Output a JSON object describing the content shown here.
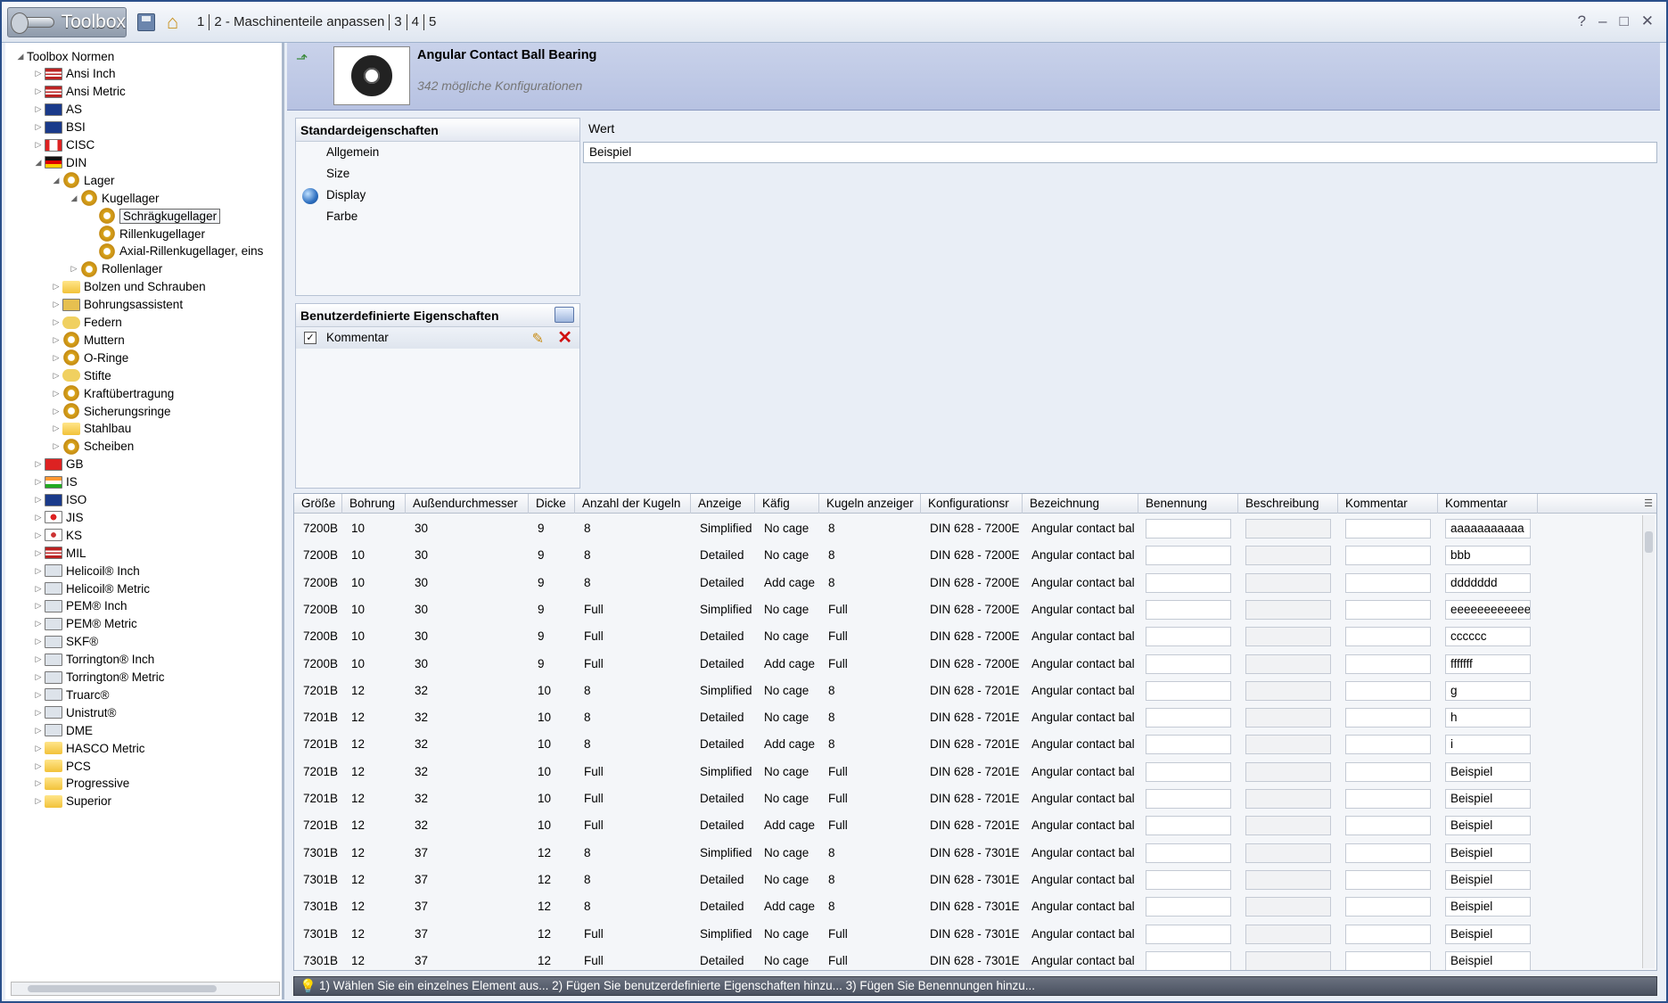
{
  "app": {
    "title": "Toolbox"
  },
  "breadcrumb": [
    "1",
    "2 - Maschinenteile anpassen",
    "3",
    "4",
    "5"
  ],
  "window_controls": [
    "?",
    "–",
    "□",
    "✕"
  ],
  "tree": [
    {
      "label": "Toolbox Normen",
      "level": 0,
      "expanded": true,
      "icon": "none"
    },
    {
      "label": "Ansi Inch",
      "level": 1,
      "icon": "flag-us"
    },
    {
      "label": "Ansi Metric",
      "level": 1,
      "icon": "flag-us"
    },
    {
      "label": "AS",
      "level": 1,
      "icon": "flag-au"
    },
    {
      "label": "BSI",
      "level": 1,
      "icon": "flag-uk"
    },
    {
      "label": "CISC",
      "level": 1,
      "icon": "flag-ca"
    },
    {
      "label": "DIN",
      "level": 1,
      "expanded": true,
      "icon": "flag-de"
    },
    {
      "label": "Lager",
      "level": 2,
      "expanded": true,
      "icon": "gear"
    },
    {
      "label": "Kugellager",
      "level": 3,
      "expanded": true,
      "icon": "gear"
    },
    {
      "label": "Schrägkugellager",
      "level": 4,
      "icon": "gear",
      "selected": true
    },
    {
      "label": "Rillenkugellager",
      "level": 4,
      "icon": "gear"
    },
    {
      "label": "Axial-Rillenkugellager, eins",
      "level": 4,
      "icon": "gear"
    },
    {
      "label": "Rollenlager",
      "level": 3,
      "icon": "gear"
    },
    {
      "label": "Bolzen und Schrauben",
      "level": 2,
      "icon": "folder"
    },
    {
      "label": "Bohrungsassistent",
      "level": 2,
      "icon": "drill"
    },
    {
      "label": "Federn",
      "level": 2,
      "icon": "part"
    },
    {
      "label": "Muttern",
      "level": 2,
      "icon": "gear"
    },
    {
      "label": "O-Ringe",
      "level": 2,
      "icon": "gear"
    },
    {
      "label": "Stifte",
      "level": 2,
      "icon": "part"
    },
    {
      "label": "Kraftübertragung",
      "level": 2,
      "icon": "gear"
    },
    {
      "label": "Sicherungsringe",
      "level": 2,
      "icon": "gear"
    },
    {
      "label": "Stahlbau",
      "level": 2,
      "icon": "folder"
    },
    {
      "label": "Scheiben",
      "level": 2,
      "icon": "gear"
    },
    {
      "label": "GB",
      "level": 1,
      "icon": "flag-cn"
    },
    {
      "label": "IS",
      "level": 1,
      "icon": "flag-in"
    },
    {
      "label": "ISO",
      "level": 1,
      "icon": "flag-iso"
    },
    {
      "label": "JIS",
      "level": 1,
      "icon": "flag-jp"
    },
    {
      "label": "KS",
      "level": 1,
      "icon": "flag-kr"
    },
    {
      "label": "MIL",
      "level": 1,
      "icon": "flag-us"
    },
    {
      "label": "Helicoil® Inch",
      "level": 1,
      "icon": "vendor"
    },
    {
      "label": "Helicoil® Metric",
      "level": 1,
      "icon": "vendor"
    },
    {
      "label": "PEM® Inch",
      "level": 1,
      "icon": "vendor"
    },
    {
      "label": "PEM® Metric",
      "level": 1,
      "icon": "vendor"
    },
    {
      "label": "SKF®",
      "level": 1,
      "icon": "vendor"
    },
    {
      "label": "Torrington® Inch",
      "level": 1,
      "icon": "vendor"
    },
    {
      "label": "Torrington® Metric",
      "level": 1,
      "icon": "vendor"
    },
    {
      "label": "Truarc®",
      "level": 1,
      "icon": "vendor"
    },
    {
      "label": "Unistrut®",
      "level": 1,
      "icon": "vendor"
    },
    {
      "label": "DME",
      "level": 1,
      "icon": "vendor"
    },
    {
      "label": "HASCO Metric",
      "level": 1,
      "icon": "folder"
    },
    {
      "label": "PCS",
      "level": 1,
      "icon": "folder"
    },
    {
      "label": "Progressive",
      "level": 1,
      "icon": "folder"
    },
    {
      "label": "Superior",
      "level": 1,
      "icon": "folder"
    }
  ],
  "component": {
    "title": "Angular Contact Ball Bearing",
    "subtitle": "342 mögliche Konfigurationen"
  },
  "standard_props": {
    "title": "Standardeigenschaften",
    "items": [
      "Allgemein",
      "Size",
      "Display",
      "Farbe"
    ]
  },
  "custom_props": {
    "title": "Benutzerdefinierte Eigenschaften",
    "items": [
      {
        "label": "Kommentar",
        "checked": true
      }
    ]
  },
  "value": {
    "label": "Wert",
    "field": "Beispiel"
  },
  "grid": {
    "columns": [
      "Größe",
      "Bohrung",
      "Außendurchmesser",
      "Dicke",
      "Anzahl der Kugeln",
      "Anzeige",
      "Käfig",
      "Kugeln anzeiger",
      "Konfigurationsr",
      "Bezeichnung",
      "Benennung",
      "Beschreibung",
      "Kommentar",
      "Kommentar"
    ],
    "rows": [
      [
        "7200B",
        "10",
        "30",
        "9",
        "8",
        "Simplified",
        "No cage",
        "8",
        "DIN 628 - 7200E",
        "Angular contact bal",
        "",
        "",
        "",
        "aaaaaaaaaaa"
      ],
      [
        "7200B",
        "10",
        "30",
        "9",
        "8",
        "Detailed",
        "No cage",
        "8",
        "DIN 628 - 7200E",
        "Angular contact bal",
        "",
        "",
        "",
        "bbb"
      ],
      [
        "7200B",
        "10",
        "30",
        "9",
        "8",
        "Detailed",
        "Add cage",
        "8",
        "DIN 628 - 7200E",
        "Angular contact bal",
        "",
        "",
        "",
        "ddddddd"
      ],
      [
        "7200B",
        "10",
        "30",
        "9",
        "Full",
        "Simplified",
        "No cage",
        "Full",
        "DIN 628 - 7200E",
        "Angular contact bal",
        "",
        "",
        "",
        "eeeeeeeeeeee"
      ],
      [
        "7200B",
        "10",
        "30",
        "9",
        "Full",
        "Detailed",
        "No cage",
        "Full",
        "DIN 628 - 7200E",
        "Angular contact bal",
        "",
        "",
        "",
        "cccccc"
      ],
      [
        "7200B",
        "10",
        "30",
        "9",
        "Full",
        "Detailed",
        "Add cage",
        "Full",
        "DIN 628 - 7200E",
        "Angular contact bal",
        "",
        "",
        "",
        "fffffff"
      ],
      [
        "7201B",
        "12",
        "32",
        "10",
        "8",
        "Simplified",
        "No cage",
        "8",
        "DIN 628 - 7201E",
        "Angular contact bal",
        "",
        "",
        "",
        "g"
      ],
      [
        "7201B",
        "12",
        "32",
        "10",
        "8",
        "Detailed",
        "No cage",
        "8",
        "DIN 628 - 7201E",
        "Angular contact bal",
        "",
        "",
        "",
        "h"
      ],
      [
        "7201B",
        "12",
        "32",
        "10",
        "8",
        "Detailed",
        "Add cage",
        "8",
        "DIN 628 - 7201E",
        "Angular contact bal",
        "",
        "",
        "",
        "i"
      ],
      [
        "7201B",
        "12",
        "32",
        "10",
        "Full",
        "Simplified",
        "No cage",
        "Full",
        "DIN 628 - 7201E",
        "Angular contact bal",
        "",
        "",
        "",
        "Beispiel"
      ],
      [
        "7201B",
        "12",
        "32",
        "10",
        "Full",
        "Detailed",
        "No cage",
        "Full",
        "DIN 628 - 7201E",
        "Angular contact bal",
        "",
        "",
        "",
        "Beispiel"
      ],
      [
        "7201B",
        "12",
        "32",
        "10",
        "Full",
        "Detailed",
        "Add cage",
        "Full",
        "DIN 628 - 7201E",
        "Angular contact bal",
        "",
        "",
        "",
        "Beispiel"
      ],
      [
        "7301B",
        "12",
        "37",
        "12",
        "8",
        "Simplified",
        "No cage",
        "8",
        "DIN 628 - 7301E",
        "Angular contact bal",
        "",
        "",
        "",
        "Beispiel"
      ],
      [
        "7301B",
        "12",
        "37",
        "12",
        "8",
        "Detailed",
        "No cage",
        "8",
        "DIN 628 - 7301E",
        "Angular contact bal",
        "",
        "",
        "",
        "Beispiel"
      ],
      [
        "7301B",
        "12",
        "37",
        "12",
        "8",
        "Detailed",
        "Add cage",
        "8",
        "DIN 628 - 7301E",
        "Angular contact bal",
        "",
        "",
        "",
        "Beispiel"
      ],
      [
        "7301B",
        "12",
        "37",
        "12",
        "Full",
        "Simplified",
        "No cage",
        "Full",
        "DIN 628 - 7301E",
        "Angular contact bal",
        "",
        "",
        "",
        "Beispiel"
      ],
      [
        "7301B",
        "12",
        "37",
        "12",
        "Full",
        "Detailed",
        "No cage",
        "Full",
        "DIN 628 - 7301E",
        "Angular contact bal",
        "",
        "",
        "",
        "Beispiel"
      ]
    ]
  },
  "status": "1) Wählen Sie ein einzelnes Element aus... 2) Fügen Sie benutzerdefinierte Eigenschaften hinzu... 3) Fügen Sie Benennungen hinzu...",
  "colors": {
    "header_bg": "#c9d2ea",
    "window_border": "#2a4f8a",
    "gear": "#d9a51d"
  }
}
